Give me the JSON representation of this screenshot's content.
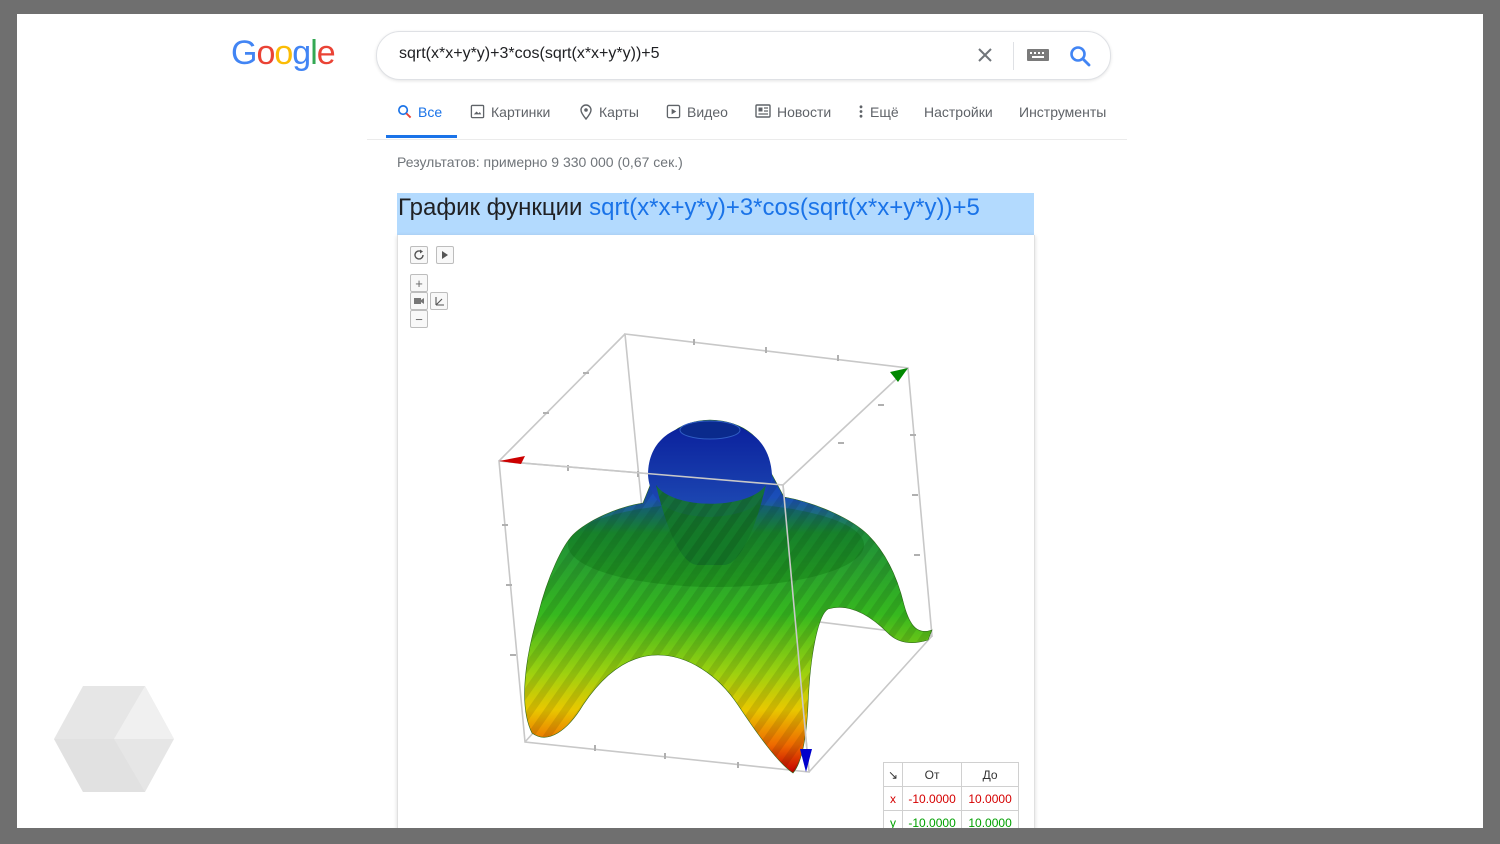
{
  "logo": {
    "text": "Google",
    "letters": [
      {
        "ch": "G",
        "color": "#4285f4"
      },
      {
        "ch": "o",
        "color": "#ea4335"
      },
      {
        "ch": "o",
        "color": "#fbbc05"
      },
      {
        "ch": "g",
        "color": "#4285f4"
      },
      {
        "ch": "l",
        "color": "#34a853"
      },
      {
        "ch": "e",
        "color": "#ea4335"
      }
    ]
  },
  "search": {
    "query": "sqrt(x*x+y*y)+3*cos(sqrt(x*x+y*y))+5"
  },
  "tabs": [
    {
      "label": "Все",
      "icon": "search-icon",
      "active": true
    },
    {
      "label": "Картинки",
      "icon": "image-icon",
      "active": false
    },
    {
      "label": "Карты",
      "icon": "map-pin-icon",
      "active": false
    },
    {
      "label": "Видео",
      "icon": "video-icon",
      "active": false
    },
    {
      "label": "Новости",
      "icon": "news-icon",
      "active": false
    },
    {
      "label": "Ещё",
      "icon": "more-vert-icon",
      "active": false
    },
    {
      "label": "Настройки",
      "icon": "",
      "active": false
    },
    {
      "label": "Инструменты",
      "icon": "",
      "active": false
    }
  ],
  "result_stats": "Результатов: примерно 9 330 000 (0,67 сек.)",
  "graph": {
    "heading_prefix": "График функции ",
    "heading_function": "sqrt(x*x+y*y)+3*cos(sqrt(x*x+y*y))+5",
    "controls": {
      "zoom_in": "+",
      "zoom_out": "−"
    },
    "range_table": {
      "corner_icon": "↘",
      "headers": [
        "От",
        "До"
      ],
      "rows": [
        {
          "axis": "x",
          "from": "-10.0000",
          "to": "10.0000",
          "color": "#d50000"
        },
        {
          "axis": "y",
          "from": "-10.0000",
          "to": "10.0000",
          "color": "#00a000"
        }
      ]
    },
    "axis_colors": {
      "x": "#cc0000",
      "y": "#008800",
      "z": "#0000cc"
    }
  }
}
